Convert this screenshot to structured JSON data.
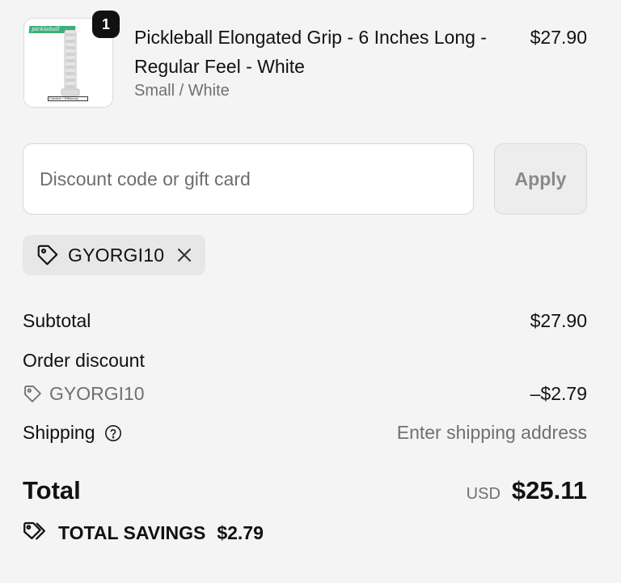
{
  "product": {
    "brand_text": "pickleball",
    "image_caption": "Comfort + Efficiency",
    "quantity": "1",
    "name": "Pickleball Elongated Grip - 6 Inches Long - Regular Feel - White",
    "variant": "Small / White",
    "price": "$27.90"
  },
  "discount": {
    "placeholder": "Discount code or gift card",
    "value": "",
    "apply_label": "Apply",
    "applied_code": "GYORGI10"
  },
  "summary": {
    "subtotal_label": "Subtotal",
    "subtotal_value": "$27.90",
    "order_discount_label": "Order discount",
    "discount_code": "GYORGI10",
    "discount_value": "–$2.79",
    "shipping_label": "Shipping",
    "shipping_value": "Enter shipping address",
    "total_label": "Total",
    "total_currency": "USD",
    "total_value": "$25.11",
    "savings_label": "TOTAL SAVINGS",
    "savings_value": "$2.79"
  },
  "icons": {
    "applied_code_tag": "tag-icon",
    "remove": "close-icon",
    "discount_tag": "tag-icon",
    "shipping_help": "help-circle-icon",
    "savings": "double-tag-icon"
  },
  "colors": {
    "page_background": "#f4f4f4",
    "text_primary": "#111111",
    "text_muted": "#707070",
    "badge_background": "#111111",
    "brand_green": "#3fae7a"
  }
}
